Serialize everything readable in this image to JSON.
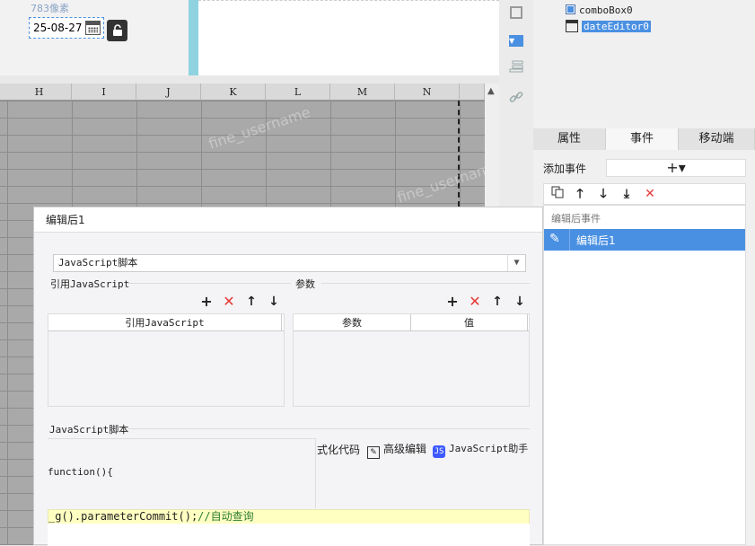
{
  "canvas": {
    "size_label": "783像素",
    "date_value": "25-08-27",
    "icons": {
      "calendar": "calendar-icon",
      "lock": "unlock-icon"
    }
  },
  "side_tools": {
    "icons": [
      "select-square-icon",
      "dropdown-widget-icon",
      "layers-icon",
      "link-icon"
    ]
  },
  "grid": {
    "columns": [
      "H",
      "I",
      "J",
      "K",
      "L",
      "M",
      "N"
    ],
    "watermark": "fine_username"
  },
  "widget_tree": {
    "items": [
      {
        "label": "comboBox0",
        "icon": "combobox-icon"
      },
      {
        "label": "dateEditor0",
        "icon": "calendar-icon",
        "selected": true
      }
    ]
  },
  "right_tabs": [
    "属性",
    "事件",
    "移动端"
  ],
  "events": {
    "add_label": "添加事件",
    "add_button": "+▾",
    "list_header": "编辑后事件",
    "items": [
      {
        "label": "编辑后1"
      }
    ],
    "toolbar_icons": [
      "copy-icon",
      "move-up-icon",
      "move-down-icon",
      "move-bottom-icon",
      "delete-icon"
    ]
  },
  "dialog": {
    "title": "编辑后1",
    "script_type": "JavaScript脚本",
    "ref_section": "引用JavaScript",
    "param_section": "参数",
    "ref_table_header": "引用JavaScript",
    "param_table_headers": [
      "参数",
      "值"
    ],
    "script_section": "JavaScript脚本",
    "format_code": "式化代码",
    "advanced_edit": "高级编辑",
    "js_helper": "JavaScript助手",
    "code_line1": "function(){",
    "code_line2_prefix": "_g().parameterCommit();",
    "code_line2_comment": "//自动查询"
  },
  "colors": {
    "accent": "#4a90e2",
    "delete_red": "#e53935",
    "code_highlight": "#ffffc2"
  }
}
